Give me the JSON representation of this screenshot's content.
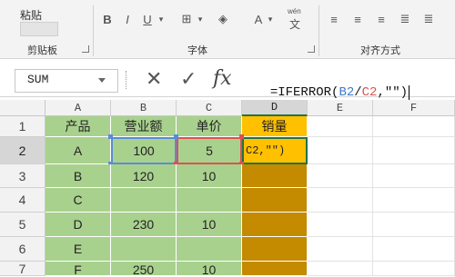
{
  "ribbon": {
    "clipboard_group_label": "剪贴板",
    "font_group_label": "字体",
    "align_group_label": "对齐方式",
    "paste_label": "粘贴",
    "bold": "B",
    "italic": "I",
    "underline": "U",
    "font_size_a": "A",
    "wen_label": "wén",
    "wen_char": "文"
  },
  "formula_bar": {
    "name_box": "SUM",
    "cancel_icon": "✕",
    "enter_icon": "✓",
    "fx_label": "fx",
    "formula_prefix": "=IFERROR(",
    "formula_ref1": "B2",
    "formula_slash": "/",
    "formula_ref2": "C2",
    "formula_suffix": ",\"\")",
    "colors": {
      "ref1": "#3c78c8",
      "ref2": "#e05050"
    }
  },
  "columns": [
    "A",
    "B",
    "C",
    "D",
    "E",
    "F"
  ],
  "rows": [
    "1",
    "2",
    "3",
    "4",
    "5",
    "6",
    "7"
  ],
  "table": {
    "headers": [
      "产品",
      "营业额",
      "单价",
      "销量"
    ],
    "data": [
      [
        "A",
        "100",
        "5",
        "C2,\"\")"
      ],
      [
        "B",
        "120",
        "10",
        ""
      ],
      [
        "C",
        "",
        "",
        ""
      ],
      [
        "D",
        "230",
        "10",
        ""
      ],
      [
        "E",
        "",
        "",
        ""
      ],
      [
        "F",
        "250",
        "10",
        ""
      ]
    ]
  },
  "colors": {
    "green": "#a9d18e",
    "orange": "#ffc000",
    "dark_orange": "#c48a00",
    "selection_blue": "#5b8bd6",
    "selection_red": "#e05050"
  }
}
